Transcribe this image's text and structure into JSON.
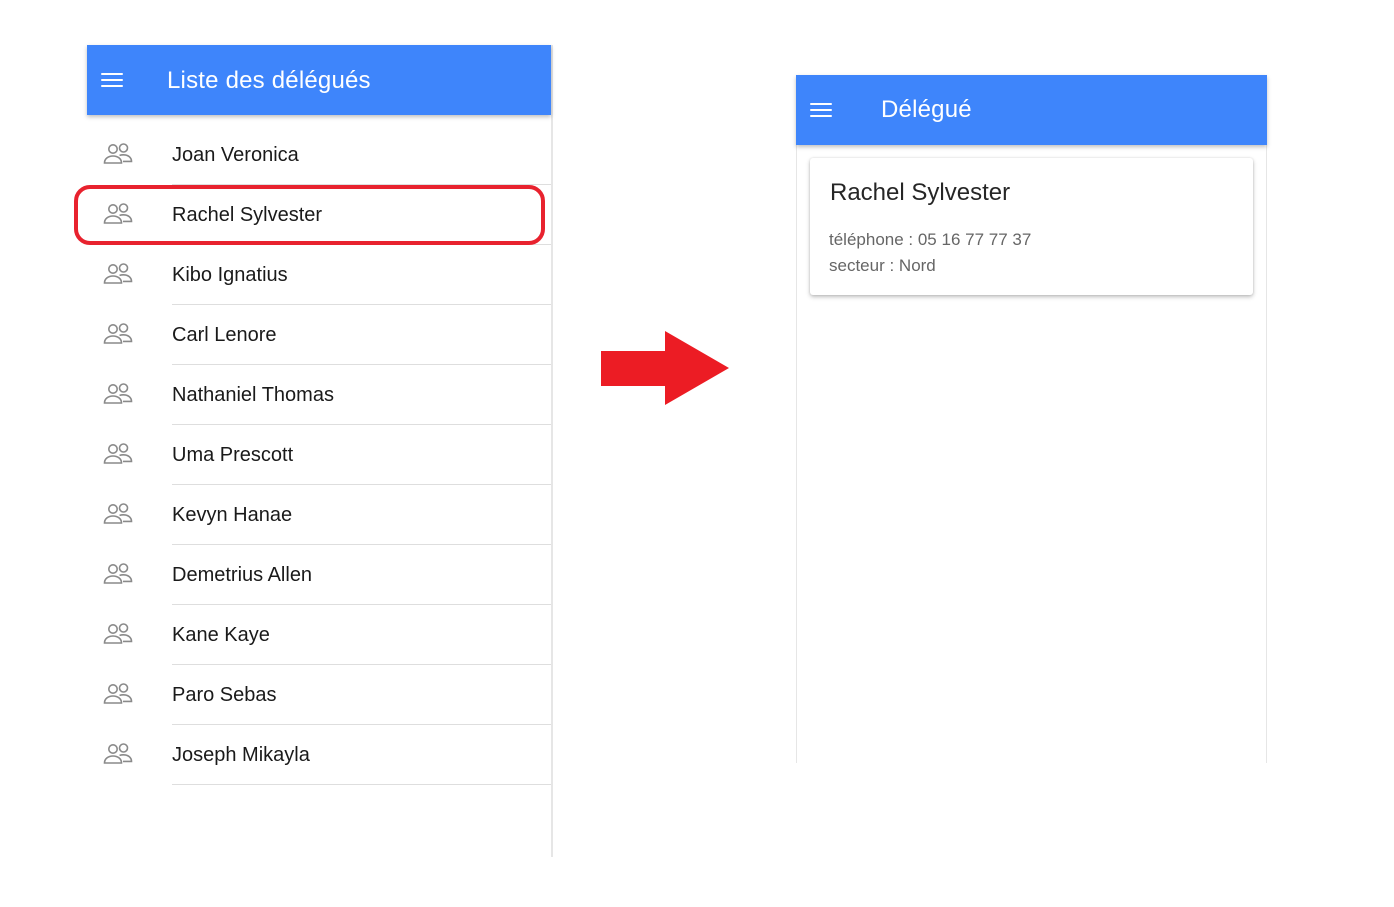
{
  "colors": {
    "toolbar": "#3e85fb",
    "highlight": "#e8222e",
    "arrow": "#ec1c24"
  },
  "list_screen": {
    "title": "Liste des délégués",
    "menu_icon": "hamburger-menu-icon",
    "item_icon": "people-icon",
    "items": [
      "Joan Veronica",
      "Rachel Sylvester",
      "Kibo Ignatius",
      "Carl Lenore",
      "Nathaniel Thomas",
      "Uma Prescott",
      "Kevyn Hanae",
      "Demetrius Allen",
      "Kane Kaye",
      "Paro Sebas",
      "Joseph Mikayla"
    ],
    "highlighted_item": "Rachel Sylvester"
  },
  "transition_icon": "arrow-right-icon",
  "detail_screen": {
    "title": "Délégué",
    "menu_icon": "hamburger-menu-icon",
    "card": {
      "name": "Rachel Sylvester",
      "phone_line": "téléphone : 05 16 77 77 37",
      "sector_line": "secteur : Nord"
    }
  }
}
